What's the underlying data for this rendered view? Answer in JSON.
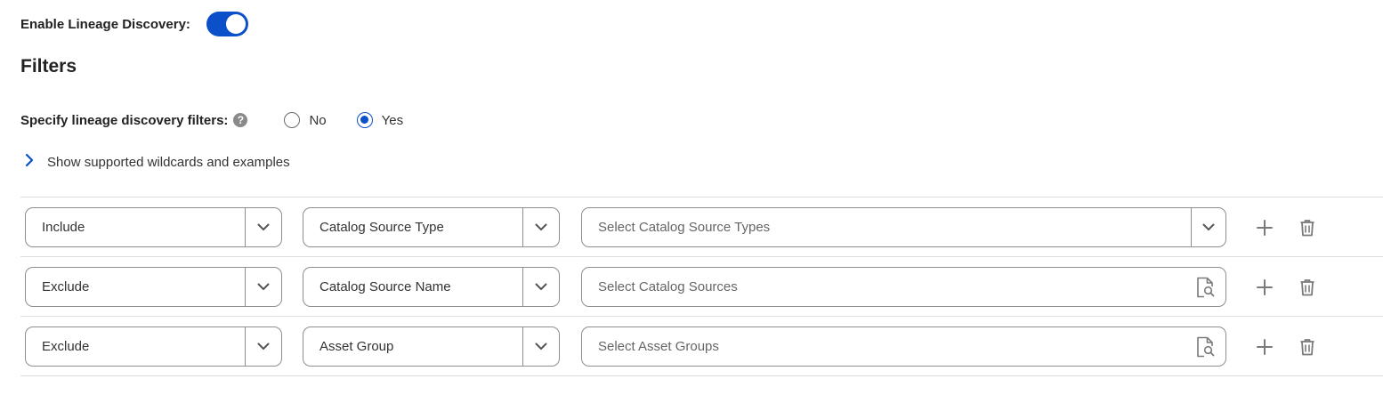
{
  "settings": {
    "enable_lineage_label": "Enable Lineage Discovery:",
    "enable_lineage_on": true
  },
  "filters": {
    "title": "Filters",
    "specify_label": "Specify lineage discovery filters:",
    "help_icon": "question-circle-icon",
    "options": [
      {
        "label": "No",
        "checked": false
      },
      {
        "label": "Yes",
        "checked": true
      }
    ],
    "wildcards_label": "Show supported wildcards and examples",
    "rows": [
      {
        "mode": "Include",
        "type": "Catalog Source Type",
        "value_placeholder": "Select Catalog Source Types",
        "value_control": "dropdown"
      },
      {
        "mode": "Exclude",
        "type": "Catalog Source Name",
        "value_placeholder": "Select Catalog Sources",
        "value_control": "search"
      },
      {
        "mode": "Exclude",
        "type": "Asset Group",
        "value_placeholder": "Select Asset Groups",
        "value_control": "search"
      }
    ]
  },
  "colors": {
    "accent": "#0b50c8",
    "border": "#8e8e8e",
    "icon": "#7a7a7a",
    "divider": "#dddddd"
  }
}
